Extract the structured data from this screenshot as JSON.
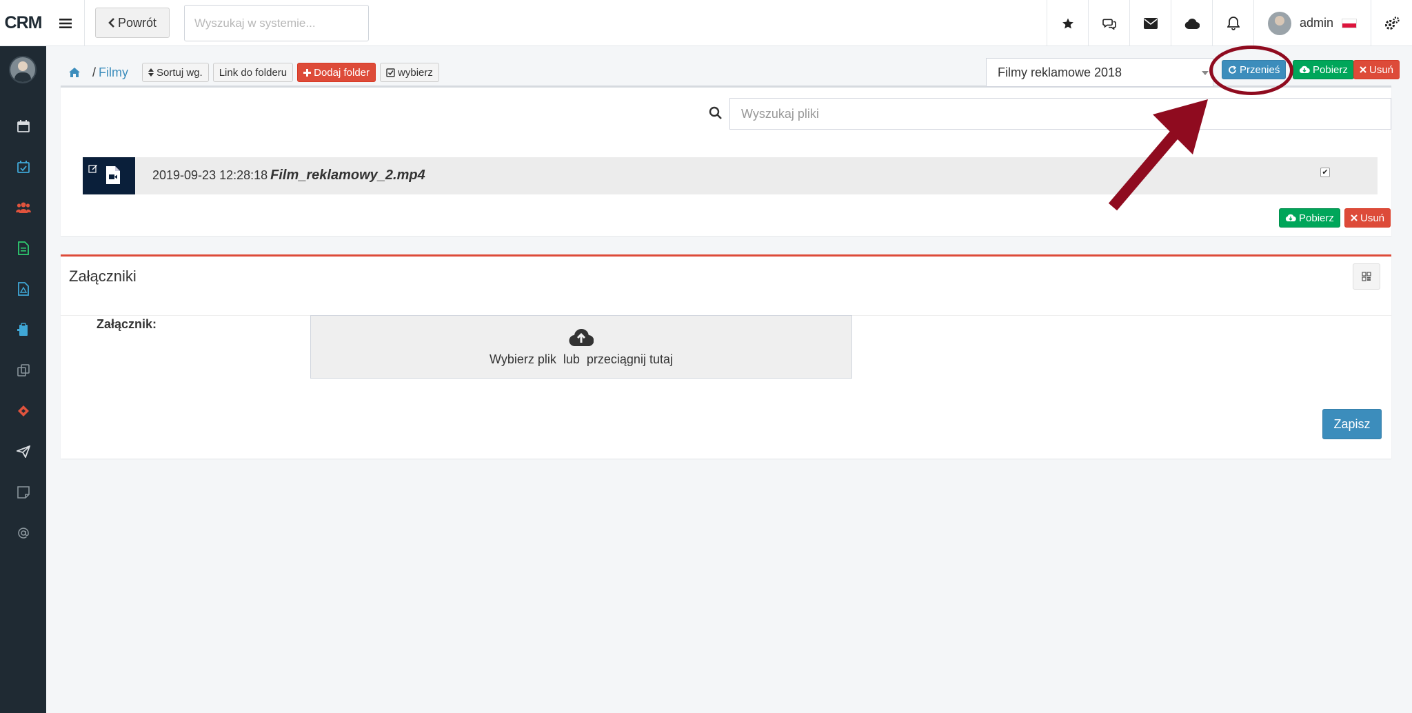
{
  "app": {
    "logo": "CRM"
  },
  "topbar": {
    "back_label": "Powrót",
    "search_placeholder": "Wyszukaj w systemie...",
    "user_name": "admin",
    "icons": [
      "star-icon",
      "comments-icon",
      "envelope-icon",
      "cloud-icon",
      "bell-icon",
      "cogs-icon"
    ]
  },
  "sidebar": {
    "items": [
      "calendar-icon",
      "calendar-check-icon",
      "users-icon",
      "document-icon",
      "pdf-icon",
      "clipboard-icon",
      "copy-icon",
      "ticket-icon",
      "paper-plane-icon",
      "note-icon",
      "at-icon"
    ]
  },
  "breadcrumb": {
    "separator": "/",
    "current": "Filmy"
  },
  "toolbar": {
    "sort_label": "Sortuj wg.",
    "link_label": "Link do folderu",
    "add_folder_label": "Dodaj folder",
    "select_label": "wybierz"
  },
  "folder_select": {
    "value": "Filmy reklamowe 2018"
  },
  "actions": {
    "move_label": "Przenieś",
    "download_label": "Pobierz",
    "delete_label": "Usuń"
  },
  "file_search": {
    "placeholder": "Wyszukaj pliki"
  },
  "files": [
    {
      "date": "2019-09-23 12:28:18",
      "name": "Film_reklamowy_2.mp4",
      "checked": true
    }
  ],
  "bottom_actions": {
    "download_label": "Pobierz",
    "delete_label": "Usuń"
  },
  "attachments": {
    "title": "Załączniki",
    "field_label": "Załącznik:",
    "dropzone_text": "Wybierz plik  lub  przeciągnij tutaj",
    "save_label": "Zapisz"
  },
  "colors": {
    "sidebar_bg": "#1f2a33",
    "primary": "#3c8dbc",
    "success": "#00a65a",
    "danger": "#dd4b39",
    "annotation": "#8f0b1f"
  }
}
